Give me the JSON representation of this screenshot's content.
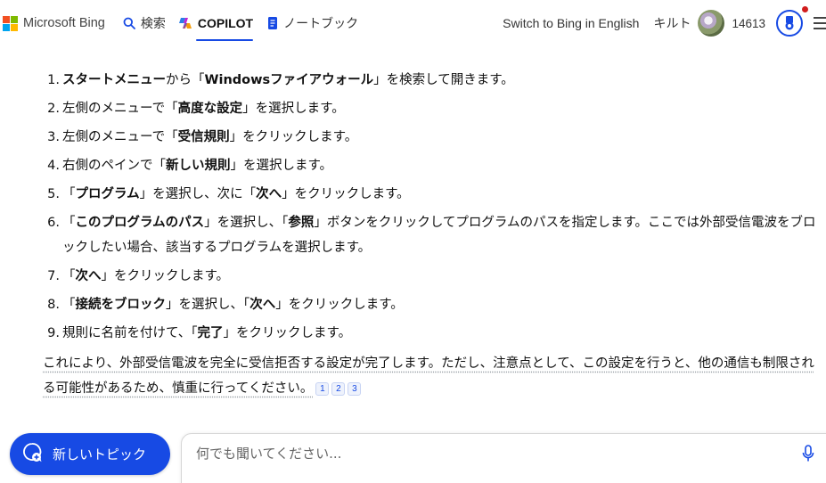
{
  "header": {
    "brand": "Microsoft Bing",
    "nav": {
      "search": "検索",
      "copilot": "COPILOT",
      "notebook": "ノートブック"
    },
    "switch_link": "Switch to Bing in English",
    "user_name": "キルト",
    "points": "14613",
    "colors": {
      "accent": "#174ae4",
      "notify": "#d11d1d"
    }
  },
  "steps": [
    {
      "num": "1.",
      "parts": [
        {
          "b": true,
          "t": "スタートメニュー"
        },
        {
          "b": false,
          "t": "から「"
        },
        {
          "b": true,
          "t": "Windowsファイアウォール"
        },
        {
          "b": false,
          "t": "」を検索して開きます。"
        }
      ]
    },
    {
      "num": "2.",
      "parts": [
        {
          "b": false,
          "t": "左側のメニューで「"
        },
        {
          "b": true,
          "t": "高度な設定"
        },
        {
          "b": false,
          "t": "」を選択します。"
        }
      ]
    },
    {
      "num": "3.",
      "parts": [
        {
          "b": false,
          "t": "左側のメニューで「"
        },
        {
          "b": true,
          "t": "受信規則"
        },
        {
          "b": false,
          "t": "」をクリックします。"
        }
      ]
    },
    {
      "num": "4.",
      "parts": [
        {
          "b": false,
          "t": "右側のペインで「"
        },
        {
          "b": true,
          "t": "新しい規則"
        },
        {
          "b": false,
          "t": "」を選択します。"
        }
      ]
    },
    {
      "num": "5.",
      "parts": [
        {
          "b": false,
          "t": "「"
        },
        {
          "b": true,
          "t": "プログラム"
        },
        {
          "b": false,
          "t": "」を選択し、次に「"
        },
        {
          "b": true,
          "t": "次へ"
        },
        {
          "b": false,
          "t": "」をクリックします。"
        }
      ]
    },
    {
      "num": "6.",
      "parts": [
        {
          "b": false,
          "t": "「"
        },
        {
          "b": true,
          "t": "このプログラムのパス"
        },
        {
          "b": false,
          "t": "」を選択し、「"
        },
        {
          "b": true,
          "t": "参照"
        },
        {
          "b": false,
          "t": "」ボタンをクリックしてプログラムのパスを指定します。ここでは外部受信電波をブロックしたい場合、該当するプログラムを選択します。"
        }
      ]
    },
    {
      "num": "7.",
      "parts": [
        {
          "b": false,
          "t": "「"
        },
        {
          "b": true,
          "t": "次へ"
        },
        {
          "b": false,
          "t": "」をクリックします。"
        }
      ]
    },
    {
      "num": "8.",
      "parts": [
        {
          "b": false,
          "t": "「"
        },
        {
          "b": true,
          "t": "接続をブロック"
        },
        {
          "b": false,
          "t": "」を選択し、「"
        },
        {
          "b": true,
          "t": "次へ"
        },
        {
          "b": false,
          "t": "」をクリックします。"
        }
      ]
    },
    {
      "num": "9.",
      "parts": [
        {
          "b": false,
          "t": "規則に名前を付けて、「"
        },
        {
          "b": true,
          "t": "完了"
        },
        {
          "b": false,
          "t": "」をクリックします。"
        }
      ]
    }
  ],
  "summary": {
    "text": "これにより、外部受信電波を完全に受信拒否する設定が完了します。ただし、注意点として、この設定を行うと、他の通信も制限される可能性があるため、慎重に行ってください。",
    "citations": [
      "1",
      "2",
      "3"
    ]
  },
  "bottom": {
    "new_topic_label": "新しいトピック",
    "input_placeholder": "何でも聞いてください..."
  }
}
